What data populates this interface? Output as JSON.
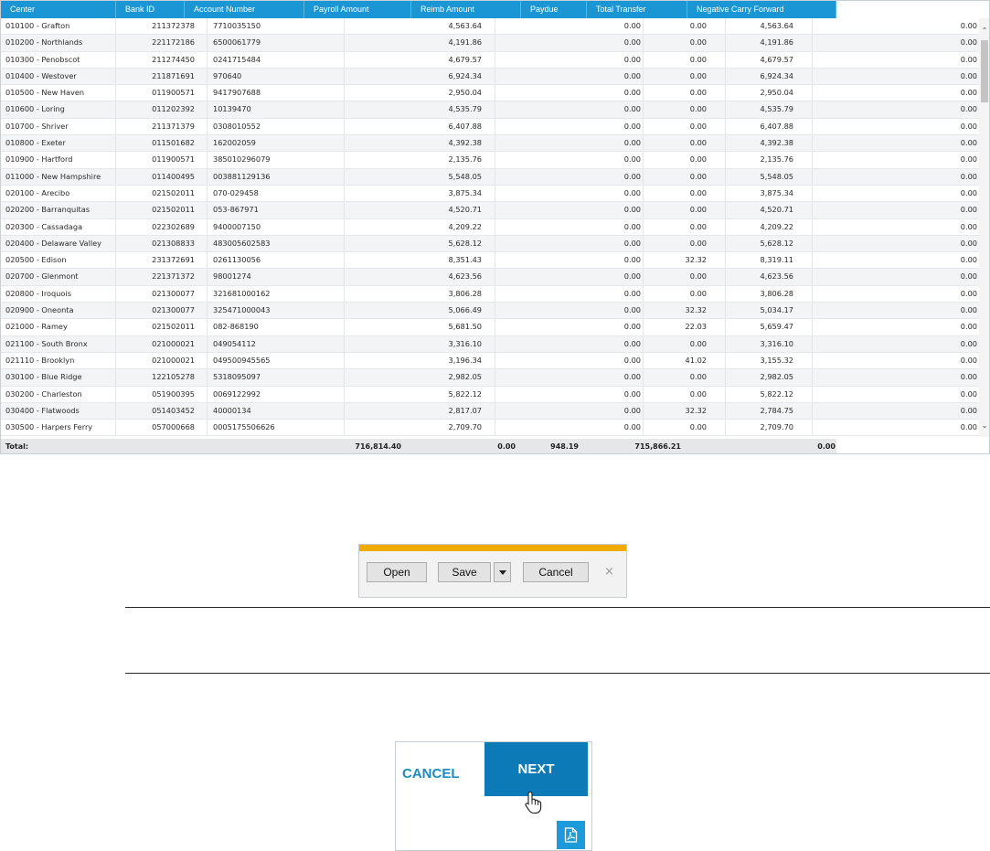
{
  "grid": {
    "columns": [
      "Center",
      "Bank ID",
      "Account Number",
      "Payroll Amount",
      "Reimb Amount",
      "Paydue",
      "Total Transfer",
      "Negative Carry Forward"
    ],
    "rows": [
      {
        "center": "010100 - Grafton",
        "bank_id": "211372378",
        "account": "7710035150",
        "payroll": "4,563.64",
        "reimb": "0.00",
        "paydue": "0.00",
        "total": "4,563.64",
        "neg_carry": "0.00"
      },
      {
        "center": "010200 - Northlands",
        "bank_id": "221172186",
        "account": "6500061779",
        "payroll": "4,191.86",
        "reimb": "0.00",
        "paydue": "0.00",
        "total": "4,191.86",
        "neg_carry": "0.00"
      },
      {
        "center": "010300 - Penobscot",
        "bank_id": "211274450",
        "account": "0241715484",
        "payroll": "4,679.57",
        "reimb": "0.00",
        "paydue": "0.00",
        "total": "4,679.57",
        "neg_carry": "0.00"
      },
      {
        "center": "010400 - Westover",
        "bank_id": "211871691",
        "account": "970640",
        "payroll": "6,924.34",
        "reimb": "0.00",
        "paydue": "0.00",
        "total": "6,924.34",
        "neg_carry": "0.00"
      },
      {
        "center": "010500 - New Haven",
        "bank_id": "011900571",
        "account": "9417907688",
        "payroll": "2,950.04",
        "reimb": "0.00",
        "paydue": "0.00",
        "total": "2,950.04",
        "neg_carry": "0.00"
      },
      {
        "center": "010600 - Loring",
        "bank_id": "011202392",
        "account": "10139470",
        "payroll": "4,535.79",
        "reimb": "0.00",
        "paydue": "0.00",
        "total": "4,535.79",
        "neg_carry": "0.00"
      },
      {
        "center": "010700 - Shriver",
        "bank_id": "211371379",
        "account": "0308010552",
        "payroll": "6,407.88",
        "reimb": "0.00",
        "paydue": "0.00",
        "total": "6,407.88",
        "neg_carry": "0.00"
      },
      {
        "center": "010800 - Exeter",
        "bank_id": "011501682",
        "account": "162002059",
        "payroll": "4,392.38",
        "reimb": "0.00",
        "paydue": "0.00",
        "total": "4,392.38",
        "neg_carry": "0.00"
      },
      {
        "center": "010900 - Hartford",
        "bank_id": "011900571",
        "account": "385010296079",
        "payroll": "2,135.76",
        "reimb": "0.00",
        "paydue": "0.00",
        "total": "2,135.76",
        "neg_carry": "0.00"
      },
      {
        "center": "011000 - New Hampshire",
        "bank_id": "011400495",
        "account": "003881129136",
        "payroll": "5,548.05",
        "reimb": "0.00",
        "paydue": "0.00",
        "total": "5,548.05",
        "neg_carry": "0.00"
      },
      {
        "center": "020100 - Arecibo",
        "bank_id": "021502011",
        "account": "070-029458",
        "payroll": "3,875.34",
        "reimb": "0.00",
        "paydue": "0.00",
        "total": "3,875.34",
        "neg_carry": "0.00"
      },
      {
        "center": "020200 - Barranquitas",
        "bank_id": "021502011",
        "account": "053-867971",
        "payroll": "4,520.71",
        "reimb": "0.00",
        "paydue": "0.00",
        "total": "4,520.71",
        "neg_carry": "0.00"
      },
      {
        "center": "020300 - Cassadaga",
        "bank_id": "022302689",
        "account": "9400007150",
        "payroll": "4,209.22",
        "reimb": "0.00",
        "paydue": "0.00",
        "total": "4,209.22",
        "neg_carry": "0.00"
      },
      {
        "center": "020400 - Delaware Valley",
        "bank_id": "021308833",
        "account": "483005602583",
        "payroll": "5,628.12",
        "reimb": "0.00",
        "paydue": "0.00",
        "total": "5,628.12",
        "neg_carry": "0.00"
      },
      {
        "center": "020500 - Edison",
        "bank_id": "231372691",
        "account": "0261130056",
        "payroll": "8,351.43",
        "reimb": "0.00",
        "paydue": "32.32",
        "total": "8,319.11",
        "neg_carry": "0.00"
      },
      {
        "center": "020700 - Glenmont",
        "bank_id": "221371372",
        "account": "98001274",
        "payroll": "4,623.56",
        "reimb": "0.00",
        "paydue": "0.00",
        "total": "4,623.56",
        "neg_carry": "0.00"
      },
      {
        "center": "020800 - Iroquois",
        "bank_id": "021300077",
        "account": "321681000162",
        "payroll": "3,806.28",
        "reimb": "0.00",
        "paydue": "0.00",
        "total": "3,806.28",
        "neg_carry": "0.00"
      },
      {
        "center": "020900 - Oneonta",
        "bank_id": "021300077",
        "account": "325471000043",
        "payroll": "5,066.49",
        "reimb": "0.00",
        "paydue": "32.32",
        "total": "5,034.17",
        "neg_carry": "0.00"
      },
      {
        "center": "021000 - Ramey",
        "bank_id": "021502011",
        "account": "082-868190",
        "payroll": "5,681.50",
        "reimb": "0.00",
        "paydue": "22.03",
        "total": "5,659.47",
        "neg_carry": "0.00"
      },
      {
        "center": "021100 - South Bronx",
        "bank_id": "021000021",
        "account": "049054112",
        "payroll": "3,316.10",
        "reimb": "0.00",
        "paydue": "0.00",
        "total": "3,316.10",
        "neg_carry": "0.00"
      },
      {
        "center": "021110 - Brooklyn",
        "bank_id": "021000021",
        "account": "049500945565",
        "payroll": "3,196.34",
        "reimb": "0.00",
        "paydue": "41.02",
        "total": "3,155.32",
        "neg_carry": "0.00"
      },
      {
        "center": "030100 - Blue Ridge",
        "bank_id": "122105278",
        "account": "5318095097",
        "payroll": "2,982.05",
        "reimb": "0.00",
        "paydue": "0.00",
        "total": "2,982.05",
        "neg_carry": "0.00"
      },
      {
        "center": "030200 - Charleston",
        "bank_id": "051900395",
        "account": "0069122992",
        "payroll": "5,822.12",
        "reimb": "0.00",
        "paydue": "0.00",
        "total": "5,822.12",
        "neg_carry": "0.00"
      },
      {
        "center": "030400 - Flatwoods",
        "bank_id": "051403452",
        "account": "40000134",
        "payroll": "2,817.07",
        "reimb": "0.00",
        "paydue": "32.32",
        "total": "2,784.75",
        "neg_carry": "0.00"
      },
      {
        "center": "030500 - Harpers Ferry",
        "bank_id": "057000668",
        "account": "0005175506626",
        "payroll": "2,709.70",
        "reimb": "0.00",
        "paydue": "0.00",
        "total": "2,709.70",
        "neg_carry": "0.00"
      }
    ],
    "totals": {
      "label": "Total:",
      "payroll": "716,814.40",
      "reimb": "0.00",
      "paydue": "948.19",
      "total": "715,866.21",
      "neg_carry": "0.00"
    }
  },
  "download_bar": {
    "open": "Open",
    "save": "Save",
    "cancel": "Cancel",
    "close": "×"
  },
  "wizard": {
    "cancel": "CANCEL",
    "next": "NEXT"
  },
  "icons": {
    "scroll_up": "chevron-up",
    "scroll_down": "chevron-down",
    "pdf": "pdf-file",
    "cursor": "hand-pointer",
    "save_menu": "dropdown-arrow"
  },
  "colors": {
    "header_bg": "#1a96d4",
    "accent_bar": "#f0ab00",
    "next_bg": "#0c7ab7",
    "cancel_text": "#1a8bc8",
    "pdf_bg": "#1d9ad9"
  }
}
